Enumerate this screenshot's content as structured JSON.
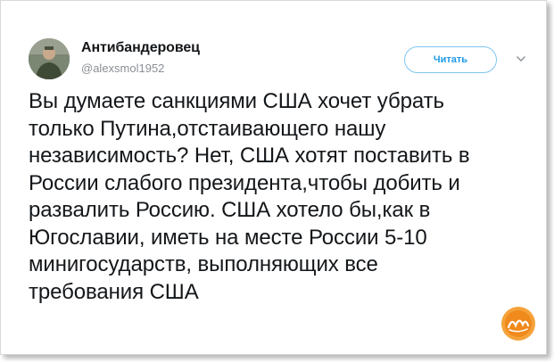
{
  "tweet": {
    "display_name": "Антибандеровец",
    "handle": "@alexsmol1952",
    "follow_label": "Читать",
    "text": "Вы думаете санкциями США хочет убрать\nтолько Путина,отстаивающего нашу\nнезависимость? Нет, США хотят поставить в\nРоссии слабого президента,чтобы добить и\nразвалить Россию. США хотело бы,как в\nЮгославии, иметь на месте России 5-10\nминигосударств, выполняющих все\nтребования США"
  },
  "icons": {
    "menu": "chevron-down-icon",
    "logo": "site-logo-icon"
  },
  "colors": {
    "accent": "#1d9ae6",
    "text": "#14171a",
    "secondary": "#8a8f96",
    "logo": "#f28a1e"
  }
}
